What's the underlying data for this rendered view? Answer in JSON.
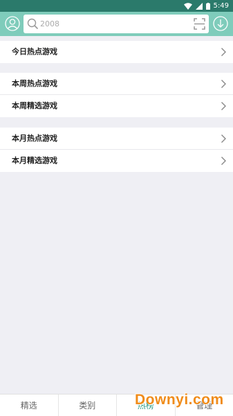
{
  "status_bar": {
    "time": "5:49",
    "icons": [
      "wifi-icon",
      "signal-icon",
      "battery-icon"
    ]
  },
  "search": {
    "placeholder": "2008"
  },
  "groups": [
    {
      "items": [
        {
          "label": "今日热点游戏"
        }
      ]
    },
    {
      "items": [
        {
          "label": "本周热点游戏"
        },
        {
          "label": "本周精选游戏"
        }
      ]
    },
    {
      "items": [
        {
          "label": "本月热点游戏"
        },
        {
          "label": "本月精选游戏"
        }
      ]
    }
  ],
  "tabs": [
    {
      "label": "精选",
      "active": false
    },
    {
      "label": "类别",
      "active": false
    },
    {
      "label": "热榜",
      "active": true
    },
    {
      "label": "管理",
      "active": false
    }
  ],
  "watermark": "Downyi.com",
  "colors": {
    "header": "#7fccbb",
    "status_bar": "#2b7a6b",
    "active_tab": "#2b9a85",
    "background": "#efeff4",
    "watermark": "#f08c1a"
  }
}
